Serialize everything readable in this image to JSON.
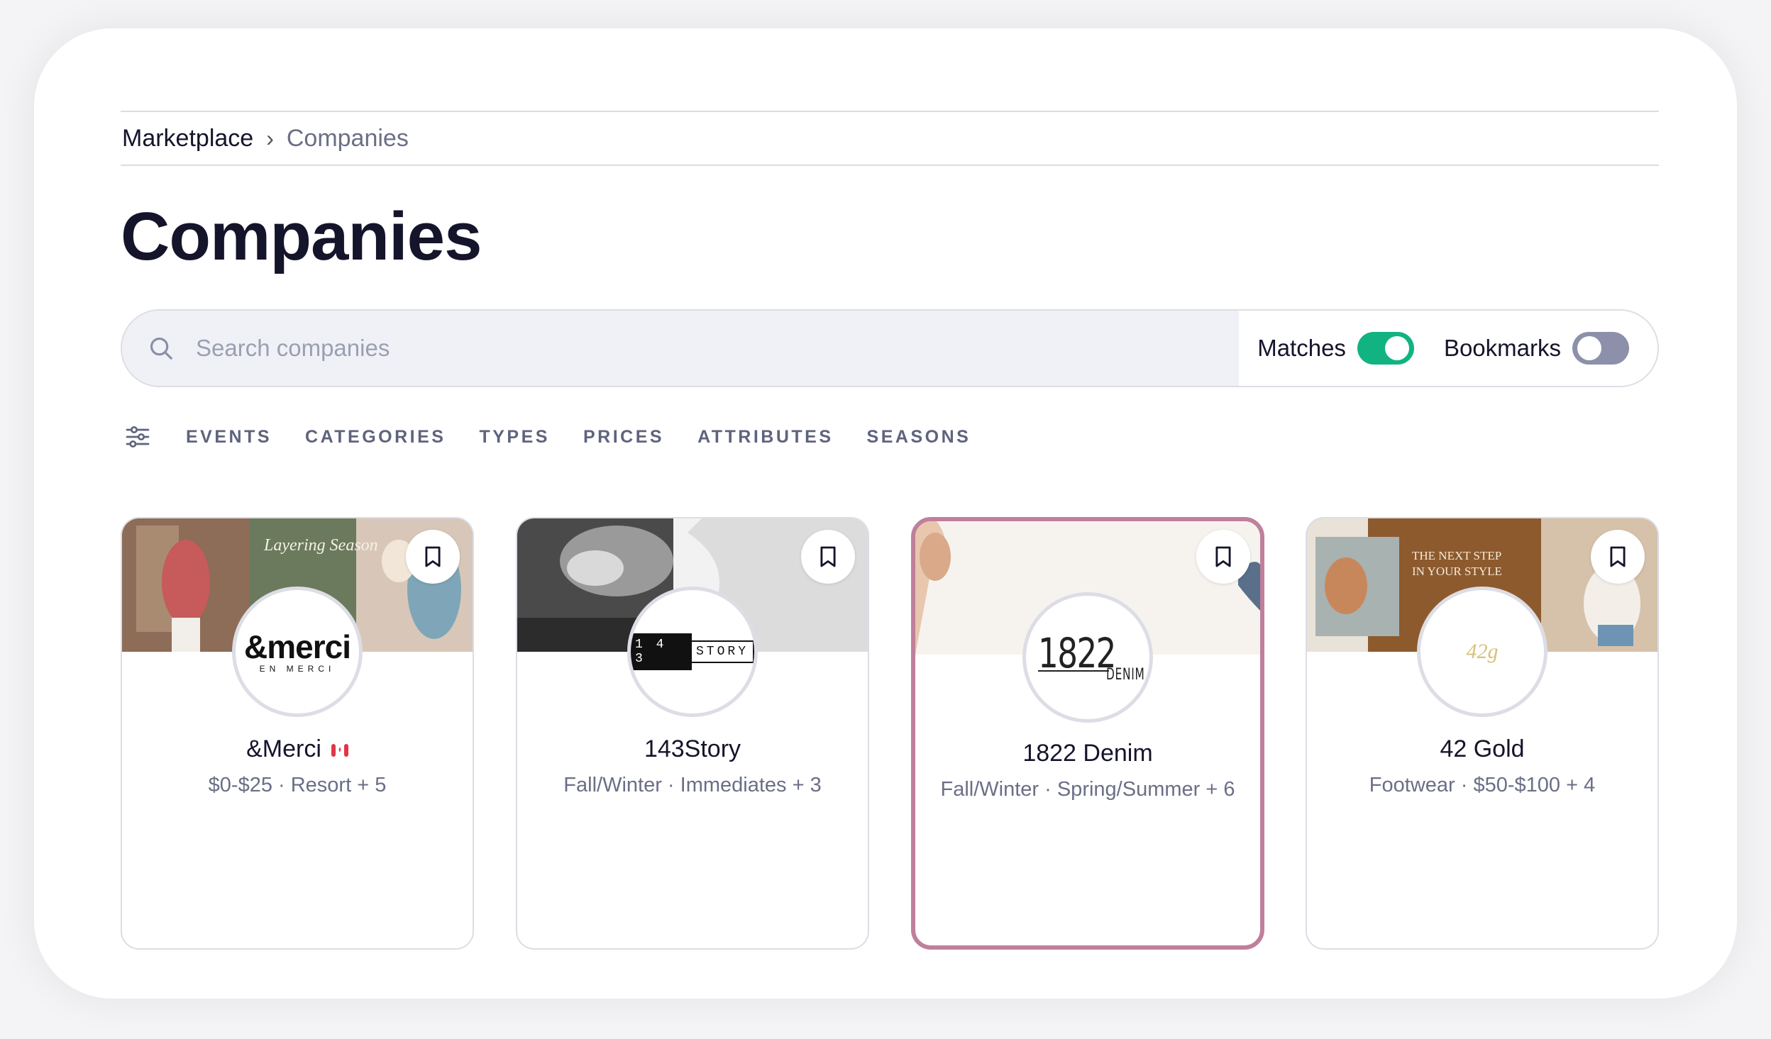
{
  "breadcrumb": {
    "root": "Marketplace",
    "separator": "›",
    "current": "Companies"
  },
  "page_title": "Companies",
  "search": {
    "placeholder": "Search companies",
    "value": ""
  },
  "toggles": {
    "matches": {
      "label": "Matches",
      "state": "on",
      "color": "#11b381"
    },
    "bookmarks": {
      "label": "Bookmarks",
      "state": "off",
      "color": "#8d90aa"
    }
  },
  "filters": [
    "EVENTS",
    "CATEGORIES",
    "TYPES",
    "PRICES",
    "ATTRIBUTES",
    "SEASONS"
  ],
  "companies": [
    {
      "name": "&Merci",
      "meta": "$0-$25 · Resort + 5",
      "logo_text": "&merci",
      "logo_sub": "EN MERCI",
      "banner_text": "Layering Season",
      "flag": "canada-flag-icon"
    },
    {
      "name": "143Story",
      "meta": "Fall/Winter · Immediates + 3",
      "logo_left": "1 4 3",
      "logo_right": "STORY"
    },
    {
      "name": "1822 Denim",
      "meta": "Fall/Winter · Spring/Summer + 6",
      "logo_text": "1822",
      "logo_sub": "DENIM",
      "selected": true
    },
    {
      "name": "42 Gold",
      "meta": "Footwear · $50-$100 + 4",
      "logo_text": "42g",
      "banner_text": "THE NEXT STEP IN YOUR STYLE"
    }
  ],
  "colors": {
    "selected_border": "#c07f9b",
    "accent_green": "#11b381",
    "muted_text": "#6a6f86"
  }
}
